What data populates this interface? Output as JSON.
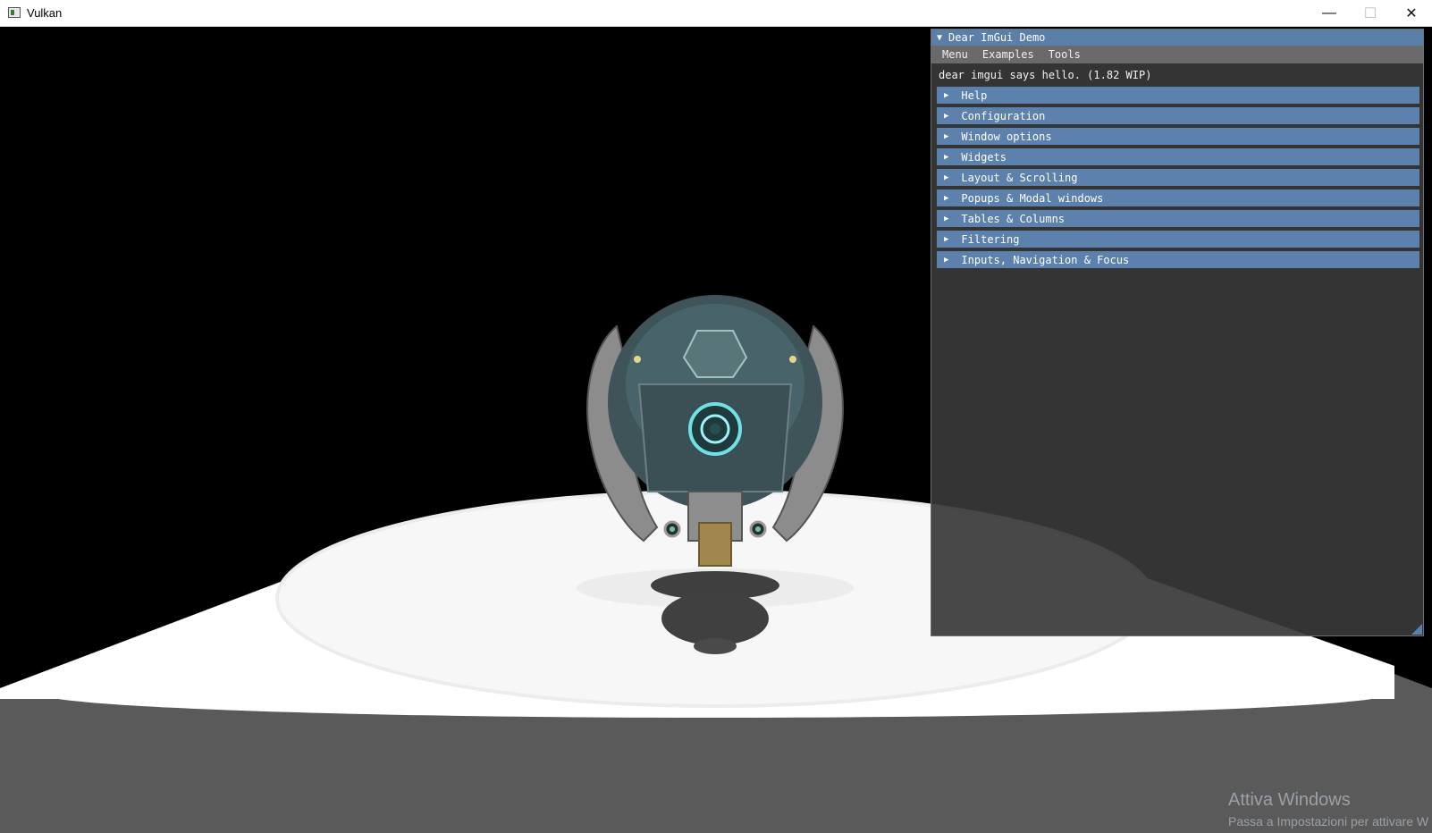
{
  "window": {
    "title": "Vulkan",
    "icon": "app-window-icon",
    "minimize": "—",
    "maximize": "☐",
    "close": "✕"
  },
  "imgui": {
    "title": "Dear ImGui Demo",
    "menu": [
      "Menu",
      "Examples",
      "Tools"
    ],
    "hello": "dear imgui says hello. (1.82 WIP)",
    "headers": [
      "Help",
      "Configuration",
      "Window options",
      "Widgets",
      "Layout & Scrolling",
      "Popups & Modal windows",
      "Tables & Columns",
      "Filtering",
      "Inputs, Navigation & Focus"
    ],
    "colors": {
      "title_bar": "#5a7fa8",
      "header": "#5b81ac",
      "menubar": "#6a6a6a",
      "body": "#383838"
    }
  },
  "watermark": {
    "line1": "Attiva Windows",
    "line2": "Passa a Impostazioni per attivare W"
  }
}
